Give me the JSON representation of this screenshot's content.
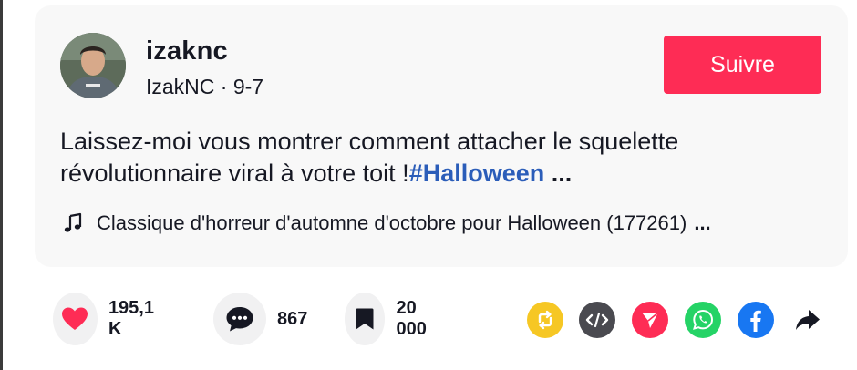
{
  "post": {
    "username": "izaknc",
    "display_name": "IzakNC",
    "separator": " · ",
    "date": "9-7",
    "follow_label": "Suivre",
    "description": "Laissez-moi vous montrer comment attacher le squelette révolutionnaire viral à votre toit !",
    "hashtag": "#Halloween",
    "ellipsis": " ...",
    "music": "Classique d'horreur d'automne d'octobre pour Halloween (177261)",
    "music_more": "..."
  },
  "actions": {
    "likes": "195,1 K",
    "comments": "867",
    "saves": "20 000"
  },
  "share_icons": [
    "repost-icon",
    "embed-icon",
    "send-icon",
    "whatsapp-icon",
    "facebook-icon",
    "share-arrow-icon"
  ],
  "colors": {
    "accent": "#fe2c55",
    "hashtag": "#2b5db9",
    "repost": "#f6c724",
    "embed": "#4a4a50",
    "send": "#fe2c55",
    "whatsapp": "#25d366",
    "facebook": "#1877f2"
  }
}
